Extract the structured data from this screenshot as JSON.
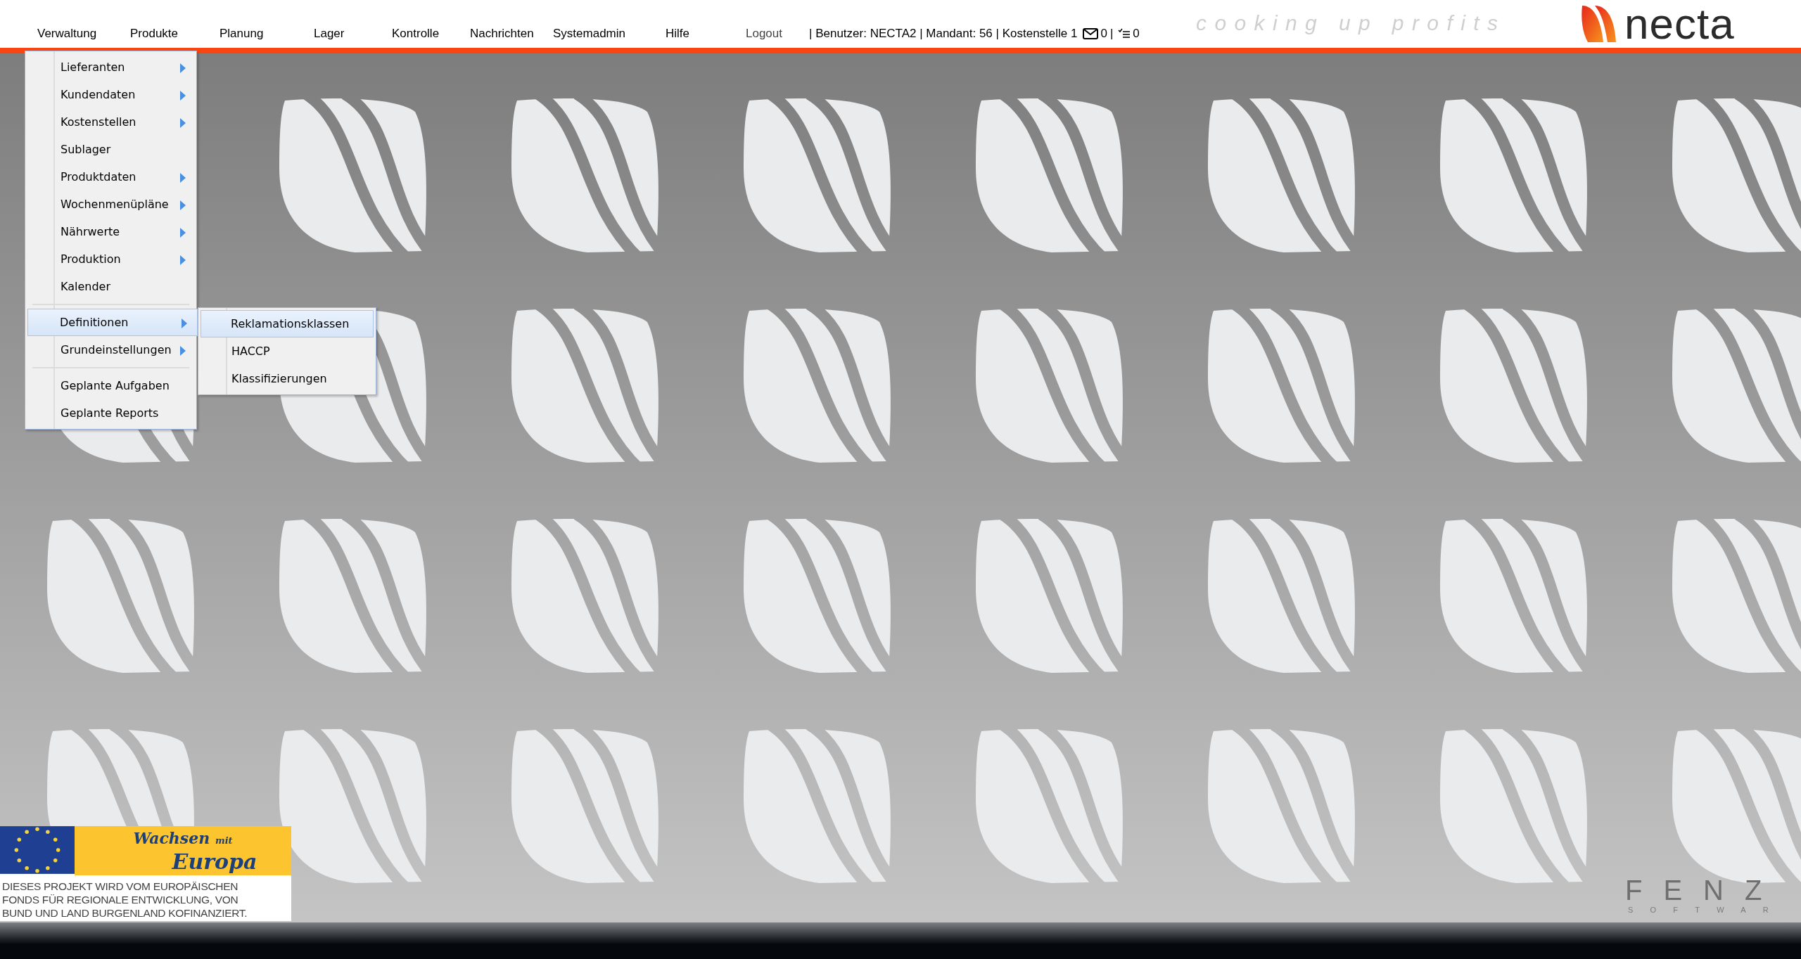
{
  "nav": [
    {
      "label": "Verwaltung"
    },
    {
      "label": "Produkte"
    },
    {
      "label": "Planung"
    },
    {
      "label": "Lager"
    },
    {
      "label": "Kontrolle"
    },
    {
      "label": "Nachrichten"
    },
    {
      "label": "Systemadmin"
    },
    {
      "label": "Hilfe"
    }
  ],
  "logout": "Logout",
  "status": {
    "text": "| Benutzer: NECTA2 | Mandant: 56 | Kostenstelle 1",
    "messages_count": "0",
    "separator": "|",
    "tasks_count": "0"
  },
  "tagline": "cooking up profits",
  "brand": "necta",
  "dropdown": {
    "groups": [
      [
        {
          "label": "Lieferanten",
          "has_submenu": true,
          "selected": false
        },
        {
          "label": "Kundendaten",
          "has_submenu": true,
          "selected": false
        },
        {
          "label": "Kostenstellen",
          "has_submenu": true,
          "selected": false
        },
        {
          "label": "Sublager",
          "has_submenu": false,
          "selected": false
        },
        {
          "label": "Produktdaten",
          "has_submenu": true,
          "selected": false
        },
        {
          "label": "Wochenmenüpläne",
          "has_submenu": true,
          "selected": false
        },
        {
          "label": "Nährwerte",
          "has_submenu": true,
          "selected": false
        },
        {
          "label": "Produktion",
          "has_submenu": true,
          "selected": false
        },
        {
          "label": "Kalender",
          "has_submenu": false,
          "selected": false
        }
      ],
      [
        {
          "label": "Definitionen",
          "has_submenu": true,
          "selected": true,
          "submenu": [
            {
              "label": "Reklamationsklassen",
              "selected": true
            },
            {
              "label": "HACCP",
              "selected": false
            },
            {
              "label": "Klassifizierungen",
              "selected": false
            }
          ]
        },
        {
          "label": "Grundeinstellungen",
          "has_submenu": true,
          "selected": false
        }
      ],
      [
        {
          "label": "Geplante Aufgaben",
          "has_submenu": false,
          "selected": false
        },
        {
          "label": "Geplante Reports",
          "has_submenu": false,
          "selected": false
        }
      ]
    ]
  },
  "eu_banner": {
    "title": "Wachsen",
    "title_small": "mit",
    "title_2": "Europa",
    "lines": [
      "DIESES PROJEKT WIRD  VOM EUROPÄISCHEN",
      "FONDS FÜR REGIONALE ENTWICKLUNG,  VON",
      "BUND UND LAND BURGENLAND KOFINANZIERT."
    ]
  },
  "vendor_logo": {
    "name": "FENZ",
    "subtitle": "SOFTWAR"
  }
}
